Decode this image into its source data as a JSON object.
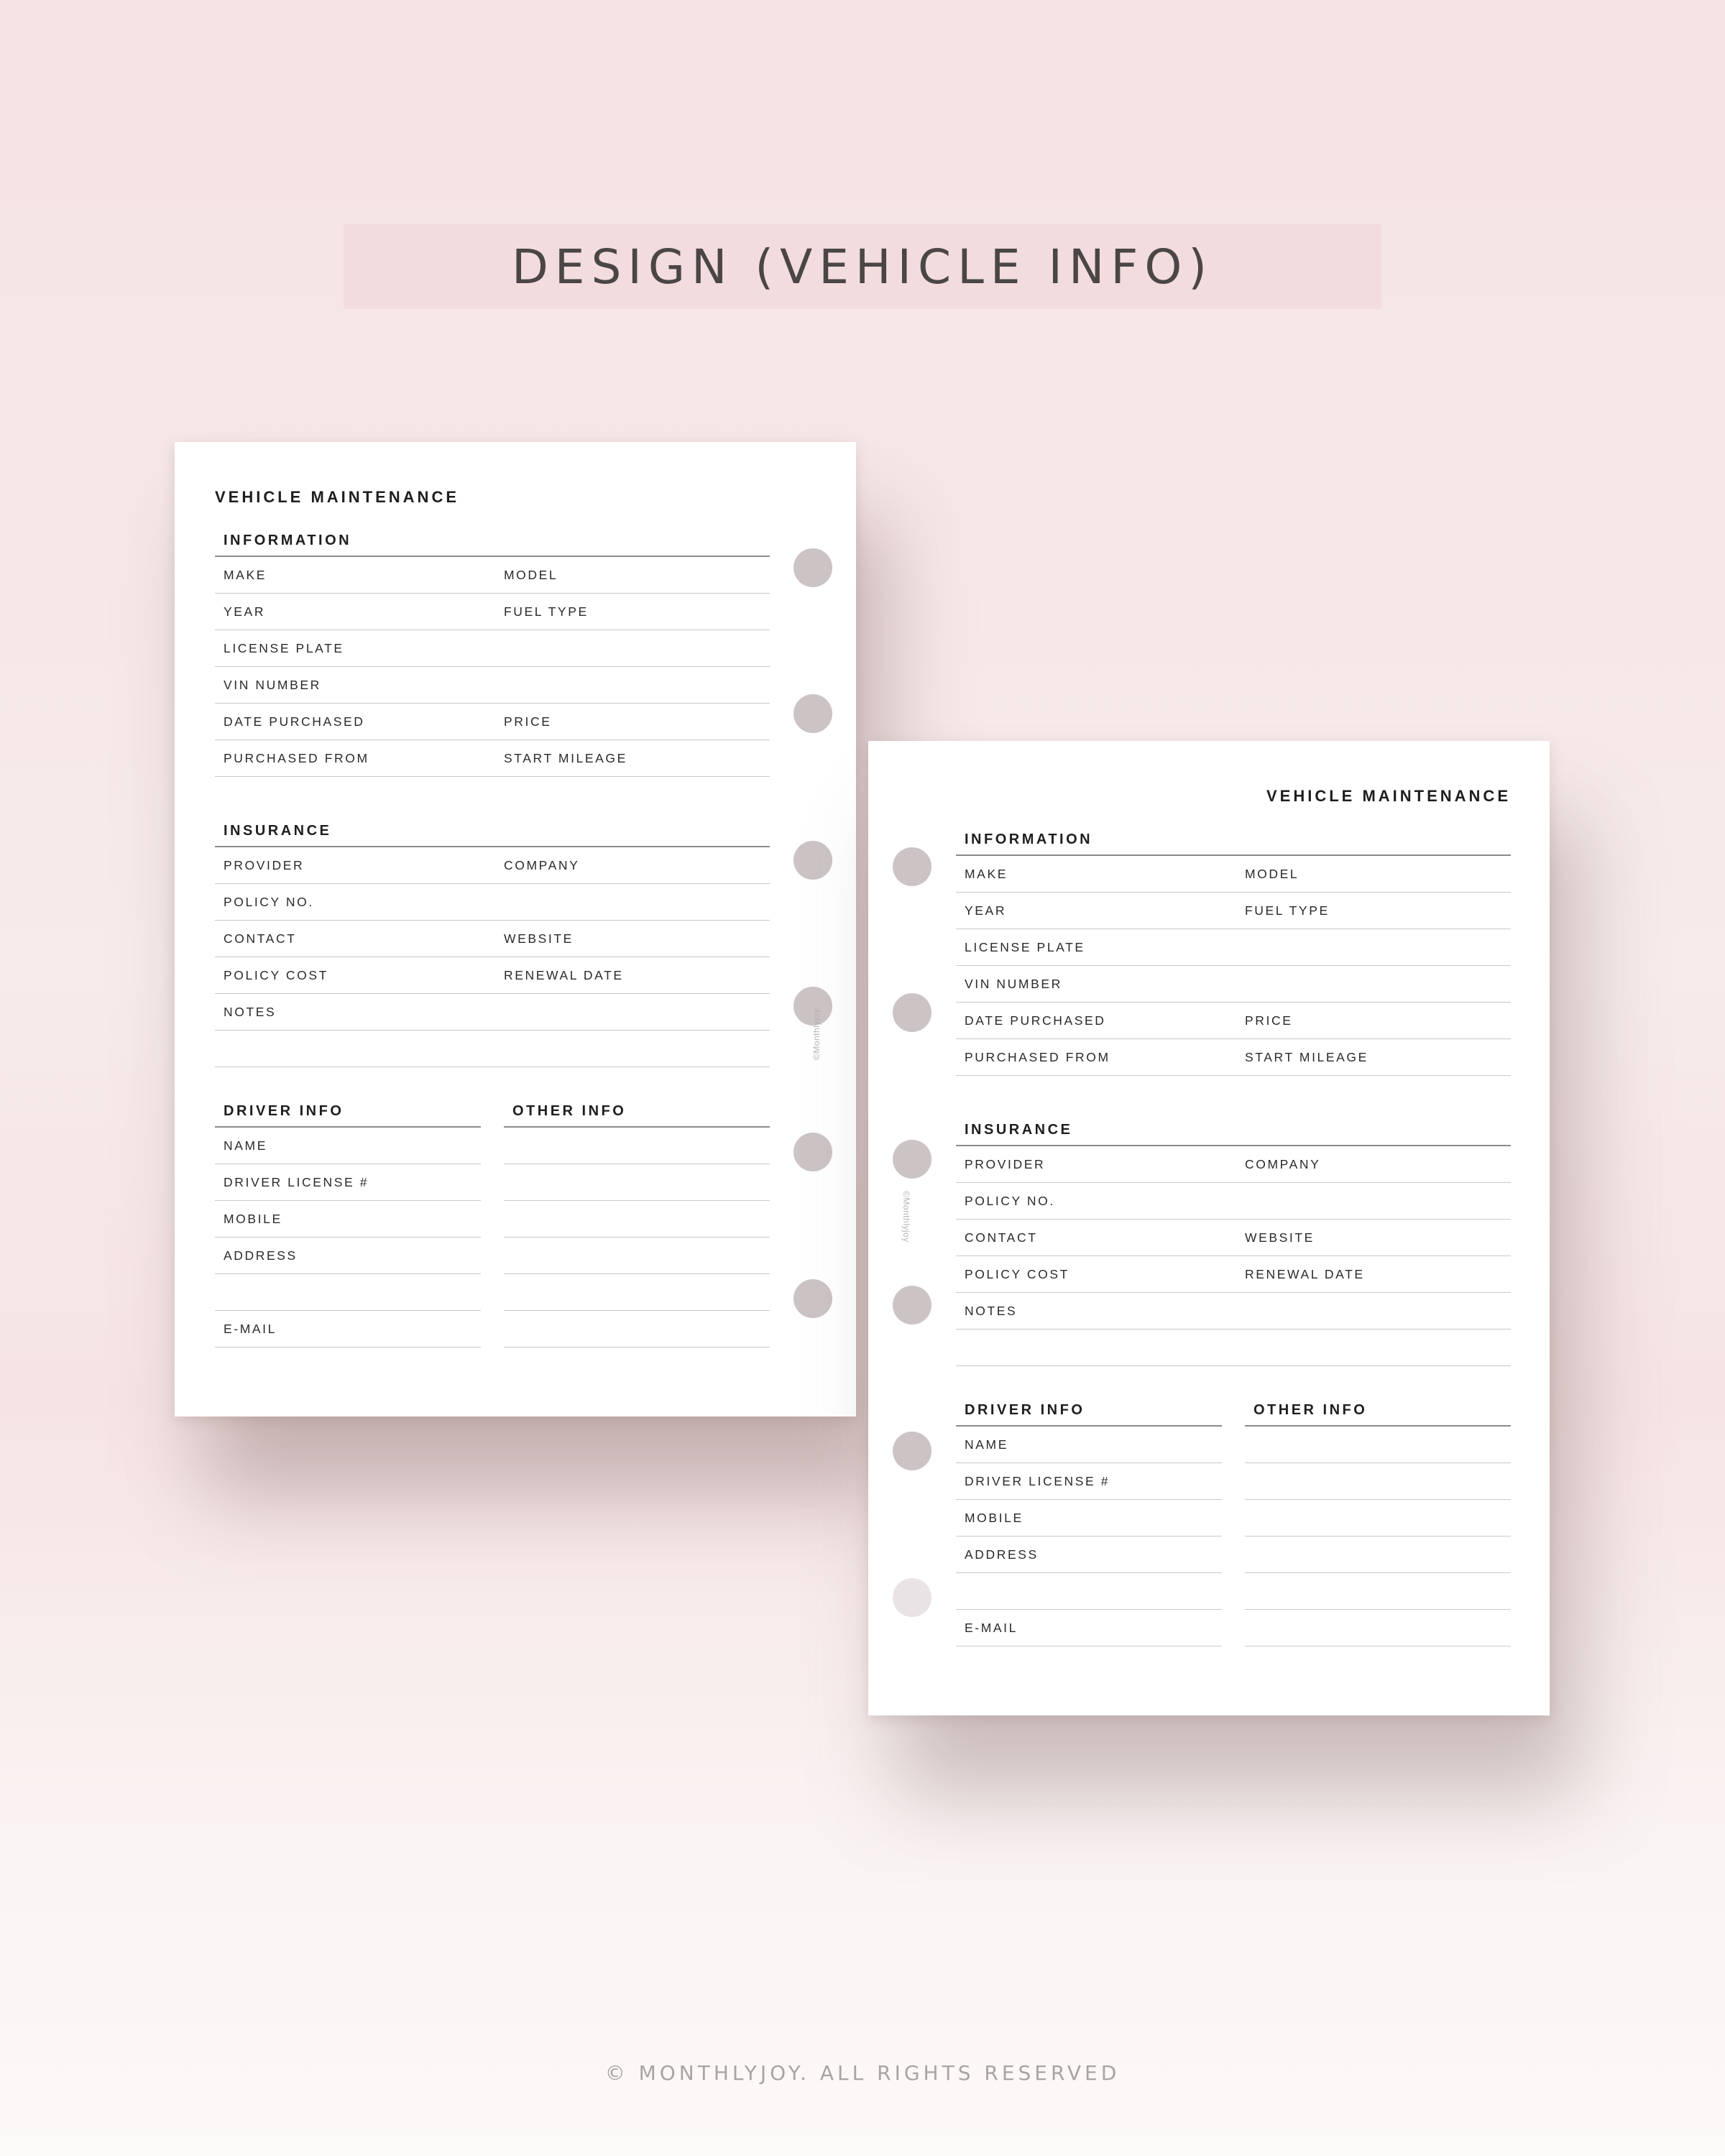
{
  "banner": {
    "title": "DESIGN (VEHICLE INFO)"
  },
  "footer": {
    "text": "© MONTHLYJOY. ALL RIGHTS RESERVED"
  },
  "form": {
    "title": "VEHICLE MAINTENANCE",
    "credit": "©Monthlyjoy",
    "information": {
      "title": "INFORMATION",
      "rows": [
        [
          "MAKE",
          "MODEL"
        ],
        [
          "YEAR",
          "FUEL TYPE"
        ],
        [
          "LICENSE PLATE",
          ""
        ],
        [
          "VIN NUMBER",
          ""
        ],
        [
          "DATE PURCHASED",
          "PRICE"
        ],
        [
          "PURCHASED FROM",
          "START MILEAGE"
        ]
      ]
    },
    "insurance": {
      "title": "INSURANCE",
      "rows": [
        [
          "PROVIDER",
          "COMPANY"
        ],
        [
          "POLICY NO.",
          ""
        ],
        [
          "CONTACT",
          "WEBSITE"
        ],
        [
          "POLICY COST",
          "RENEWAL DATE"
        ],
        [
          "NOTES",
          ""
        ],
        [
          "",
          ""
        ]
      ]
    },
    "driver": {
      "title": "DRIVER INFO",
      "rows": [
        "NAME",
        "DRIVER LICENSE #",
        "MOBILE",
        "ADDRESS",
        "",
        "E-MAIL"
      ]
    },
    "other": {
      "title": "OTHER INFO"
    }
  },
  "colors": {
    "background": "#f6e4e4",
    "banner": "#f3dcdd",
    "hole": "#cbc3c4",
    "text": "#1e1e1e"
  }
}
